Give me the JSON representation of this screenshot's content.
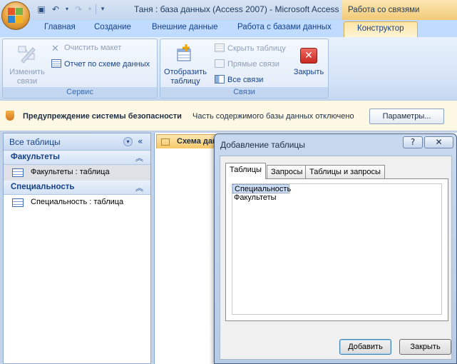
{
  "window": {
    "title": "Таня : база данных (Access 2007)  -  Microsoft Access",
    "context_tab_header": "Работа со связями"
  },
  "ribbon": {
    "tabs": [
      "Главная",
      "Создание",
      "Внешние данные",
      "Работа с базами данных",
      "Конструктор"
    ],
    "active_tab": "Конструктор",
    "groups": {
      "service": {
        "label": "Сервис",
        "change_links": "Изменить\nсвязи",
        "change_links_line1": "Изменить",
        "change_links_line2": "связи",
        "clear_layout": "Очистить макет",
        "report": "Отчет по схеме данных"
      },
      "links": {
        "label": "Связи",
        "show_table_line1": "Отобразить",
        "show_table_line2": "таблицу",
        "hide_table": "Скрыть таблицу",
        "direct_links": "Прямые связи",
        "all_links": "Все связи",
        "close": "Закрыть"
      }
    }
  },
  "security_bar": {
    "title": "Предупреждение системы безопасности",
    "message": "Часть содержимого базы данных отключено",
    "button": "Параметры..."
  },
  "nav_pane": {
    "header": "Все таблицы",
    "groups": [
      {
        "title": "Факультеты",
        "items": [
          "Факультеты : таблица"
        ]
      },
      {
        "title": "Специальность",
        "items": [
          "Специальность : таблица"
        ]
      }
    ]
  },
  "document": {
    "tab_label": "Схема данных"
  },
  "dialog": {
    "title": "Добавление таблицы",
    "help": "?",
    "close": "✕",
    "tabs": [
      "Таблицы",
      "Запросы",
      "Таблицы и запросы"
    ],
    "active_tab": "Таблицы",
    "list": [
      "Специальность",
      "Факультеты"
    ],
    "selected": "Специальность",
    "add_button": "Добавить",
    "close_button": "Закрыть"
  },
  "colors": {
    "accent": "#15428b",
    "context_tab": "#f2c976",
    "close_red": "#d9322b"
  }
}
